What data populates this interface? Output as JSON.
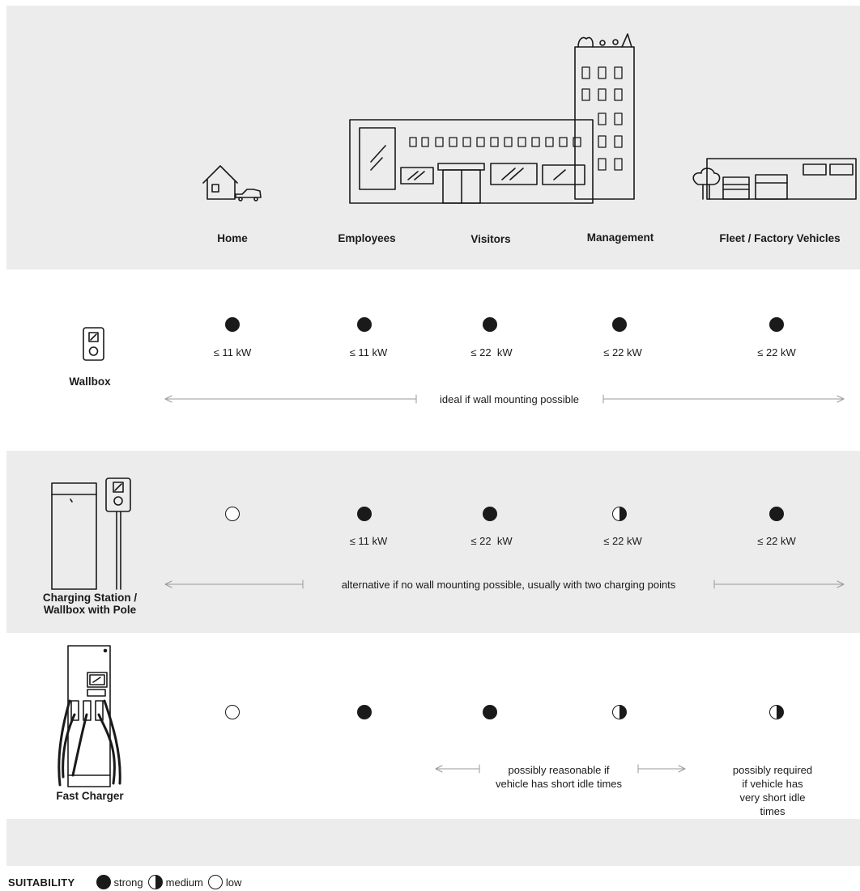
{
  "columns": [
    "Home",
    "Employees",
    "Visitors",
    "Management",
    "Fleet / Factory Vehicles"
  ],
  "rows": [
    {
      "label": "Wallbox",
      "cells": [
        {
          "level": "strong",
          "power": "≤ 11 kW"
        },
        {
          "level": "strong",
          "power": "≤ 11 kW"
        },
        {
          "level": "strong",
          "power": "≤ 22  kW"
        },
        {
          "level": "strong",
          "power": "≤ 22 kW"
        },
        {
          "level": "strong",
          "power": "≤ 22 kW"
        }
      ],
      "note": "ideal if wall mounting possible"
    },
    {
      "label": "Charging Station /\nWallbox with Pole",
      "cells": [
        {
          "level": "low",
          "power": ""
        },
        {
          "level": "strong",
          "power": "≤ 11 kW"
        },
        {
          "level": "strong",
          "power": "≤ 22  kW"
        },
        {
          "level": "medium",
          "power": "≤ 22 kW"
        },
        {
          "level": "strong",
          "power": "≤ 22 kW"
        }
      ],
      "note": "alternative if no wall mounting possible, usually with two charging points"
    },
    {
      "label": "Fast Charger",
      "cells": [
        {
          "level": "low",
          "power": ""
        },
        {
          "level": "strong",
          "power": ""
        },
        {
          "level": "strong",
          "power": ""
        },
        {
          "level": "medium",
          "power": ""
        },
        {
          "level": "medium",
          "power": ""
        }
      ],
      "notes": [
        "possibly reasonable if\nvehicle has short idle times",
        "possibly required if vehicle has\nvery short idle times"
      ]
    }
  ],
  "legend": {
    "title": "SUITABILITY",
    "items": [
      {
        "level": "strong",
        "label": "strong"
      },
      {
        "level": "medium",
        "label": "medium"
      },
      {
        "level": "low",
        "label": "low"
      }
    ]
  },
  "colors": {
    "ink": "#1a1a1a",
    "band": "#ececec",
    "arrow": "#9a9a9a"
  }
}
